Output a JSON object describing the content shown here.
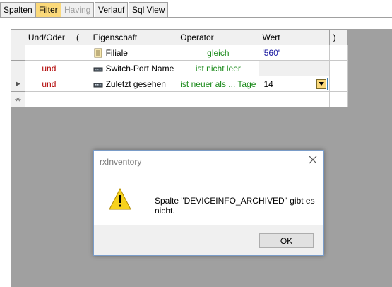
{
  "tabs": [
    {
      "label": "Spalten",
      "state": "normal"
    },
    {
      "label": "Filter",
      "state": "active"
    },
    {
      "label": "Having",
      "state": "disabled"
    },
    {
      "label": "Verlauf",
      "state": "normal"
    },
    {
      "label": "Sql View",
      "state": "normal"
    }
  ],
  "grid": {
    "headers": [
      "Und/Oder",
      "(",
      "Eigenschaft",
      "Operator",
      "Wert",
      ")"
    ],
    "rows": [
      {
        "marker": "",
        "logic": "",
        "open": "",
        "property": "Filiale",
        "property_icon": "document-icon",
        "operator": "gleich",
        "value": "'560'",
        "close": ""
      },
      {
        "marker": "",
        "logic": "und",
        "open": "",
        "property": "Switch-Port Name",
        "property_icon": "network-device-icon",
        "operator": "ist nicht leer",
        "value": "",
        "close": ""
      },
      {
        "marker": "▶",
        "logic": "und",
        "open": "",
        "property": "Zuletzt gesehen",
        "property_icon": "network-device-icon",
        "operator": "ist neuer als ... Tage",
        "value": "14",
        "close": ""
      },
      {
        "marker": "✳",
        "logic": "",
        "open": "",
        "property": "",
        "property_icon": "",
        "operator": "",
        "value": "",
        "close": ""
      }
    ]
  },
  "dialog": {
    "title": "rxInventory",
    "message": "Spalte \"DEVICEINFO_ARCHIVED\" gibt es nicht.",
    "ok_label": "OK",
    "icon": "warning-icon"
  },
  "colors": {
    "active_tab": "#fbd97a",
    "logic_text": "#b00000",
    "operator_text": "#1a8a1a",
    "value_text": "#1a1aa0",
    "workspace": "#a0a0a0"
  }
}
